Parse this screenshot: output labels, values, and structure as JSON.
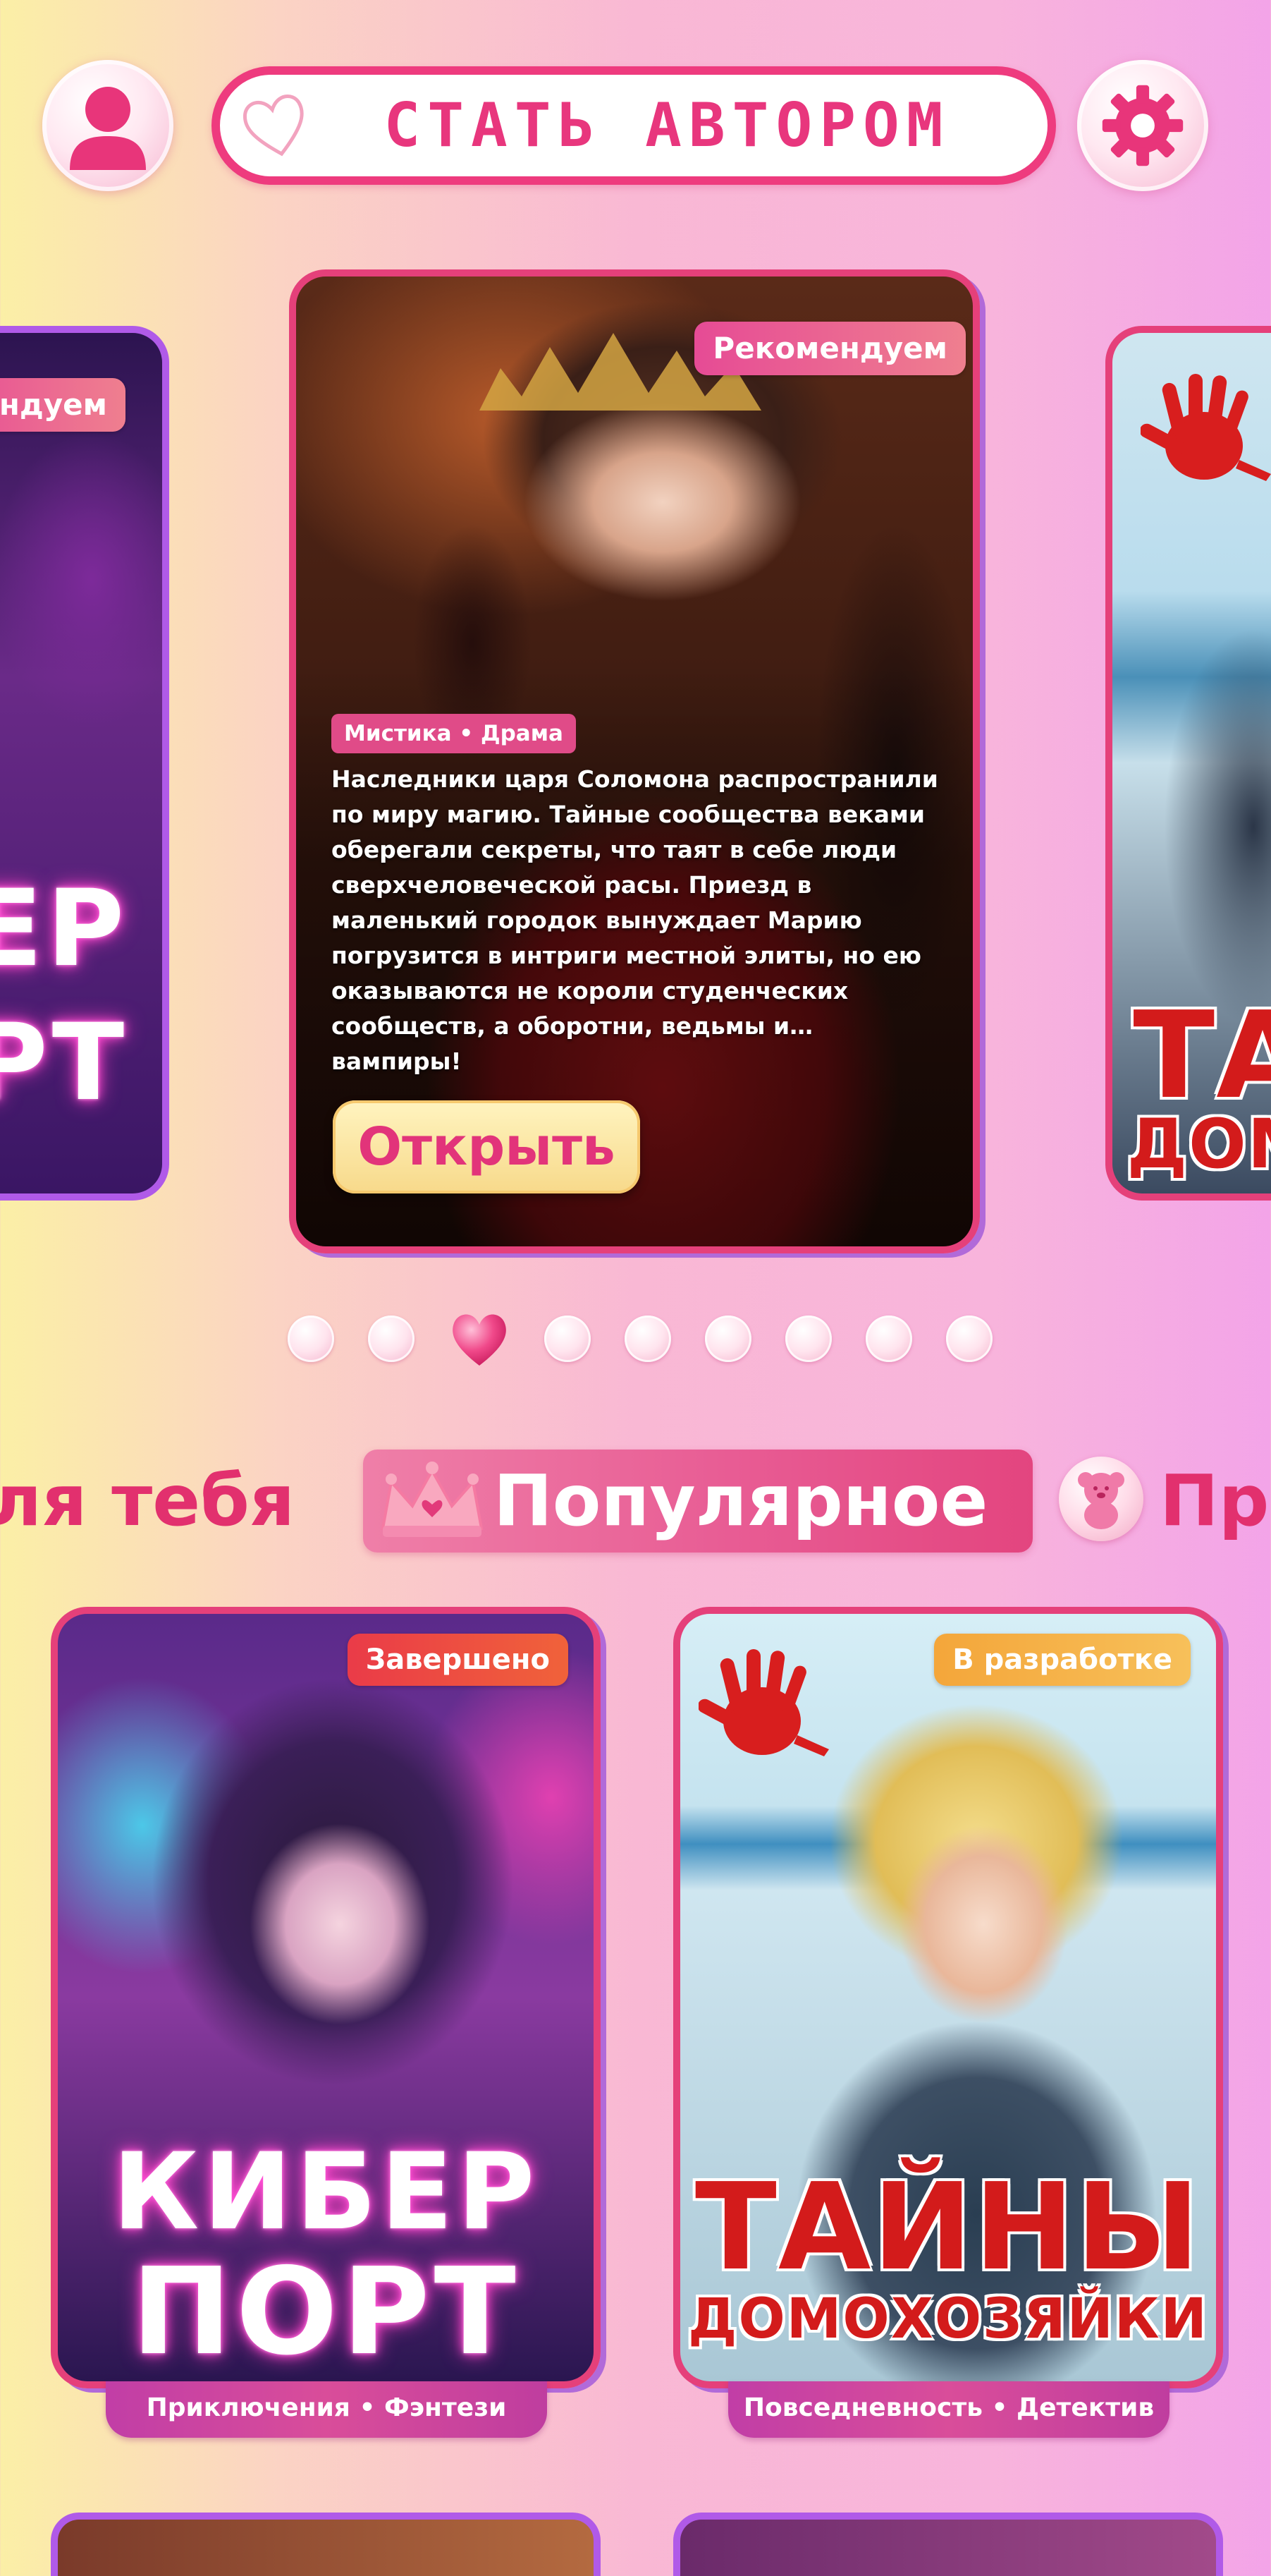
{
  "header": {
    "become_author": "СТАТЬ АВТОРОМ",
    "profile_icon": "user-icon",
    "settings_icon": "gear-icon",
    "heart_icon": "heart-outline-icon"
  },
  "carousel": {
    "left_card": {
      "badge": "мендуем",
      "title_line1": "ЕР",
      "title_line2": "РТ"
    },
    "main_card": {
      "badge": "Рекомендуем",
      "genres": "Мистика • Драма",
      "description": "Наследники царя Соломона распространили по миру магию. Тайные сообщества веками оберегали секреты, что таят в себе люди сверхчеловеческой расы. Приезд в маленький городок вынуждает Марию погрузится в интриги местной элиты, но ею оказываются не короли студенческих сообществ, а оборотни, ведьмы и… вампиры!",
      "open_button": "Открыть"
    },
    "right_card": {
      "title_line1": "ТА",
      "title_line2": "ДОМ"
    },
    "dots_count": 9,
    "active_dot": 3
  },
  "tabs": {
    "left": "ля тебя",
    "active": "Популярное",
    "right": "Пр",
    "active_icon": "crown-icon",
    "right_icon": "bear-icon"
  },
  "popular": [
    {
      "badge": "Завершено",
      "title_line1": "КИБЕР",
      "title_line2": "ПОРТ",
      "genres": "Приключения • Фэнтези"
    },
    {
      "badge": "В разработке",
      "title_line1": "ТАЙНЫ",
      "title_line2": "ДОМОХОЗЯЙКИ",
      "genres": "Повседневность • Детектив"
    }
  ],
  "colors": {
    "accent": "#e2306e",
    "card_border": "#e5407a",
    "card_shadow": "#b16ad9"
  }
}
